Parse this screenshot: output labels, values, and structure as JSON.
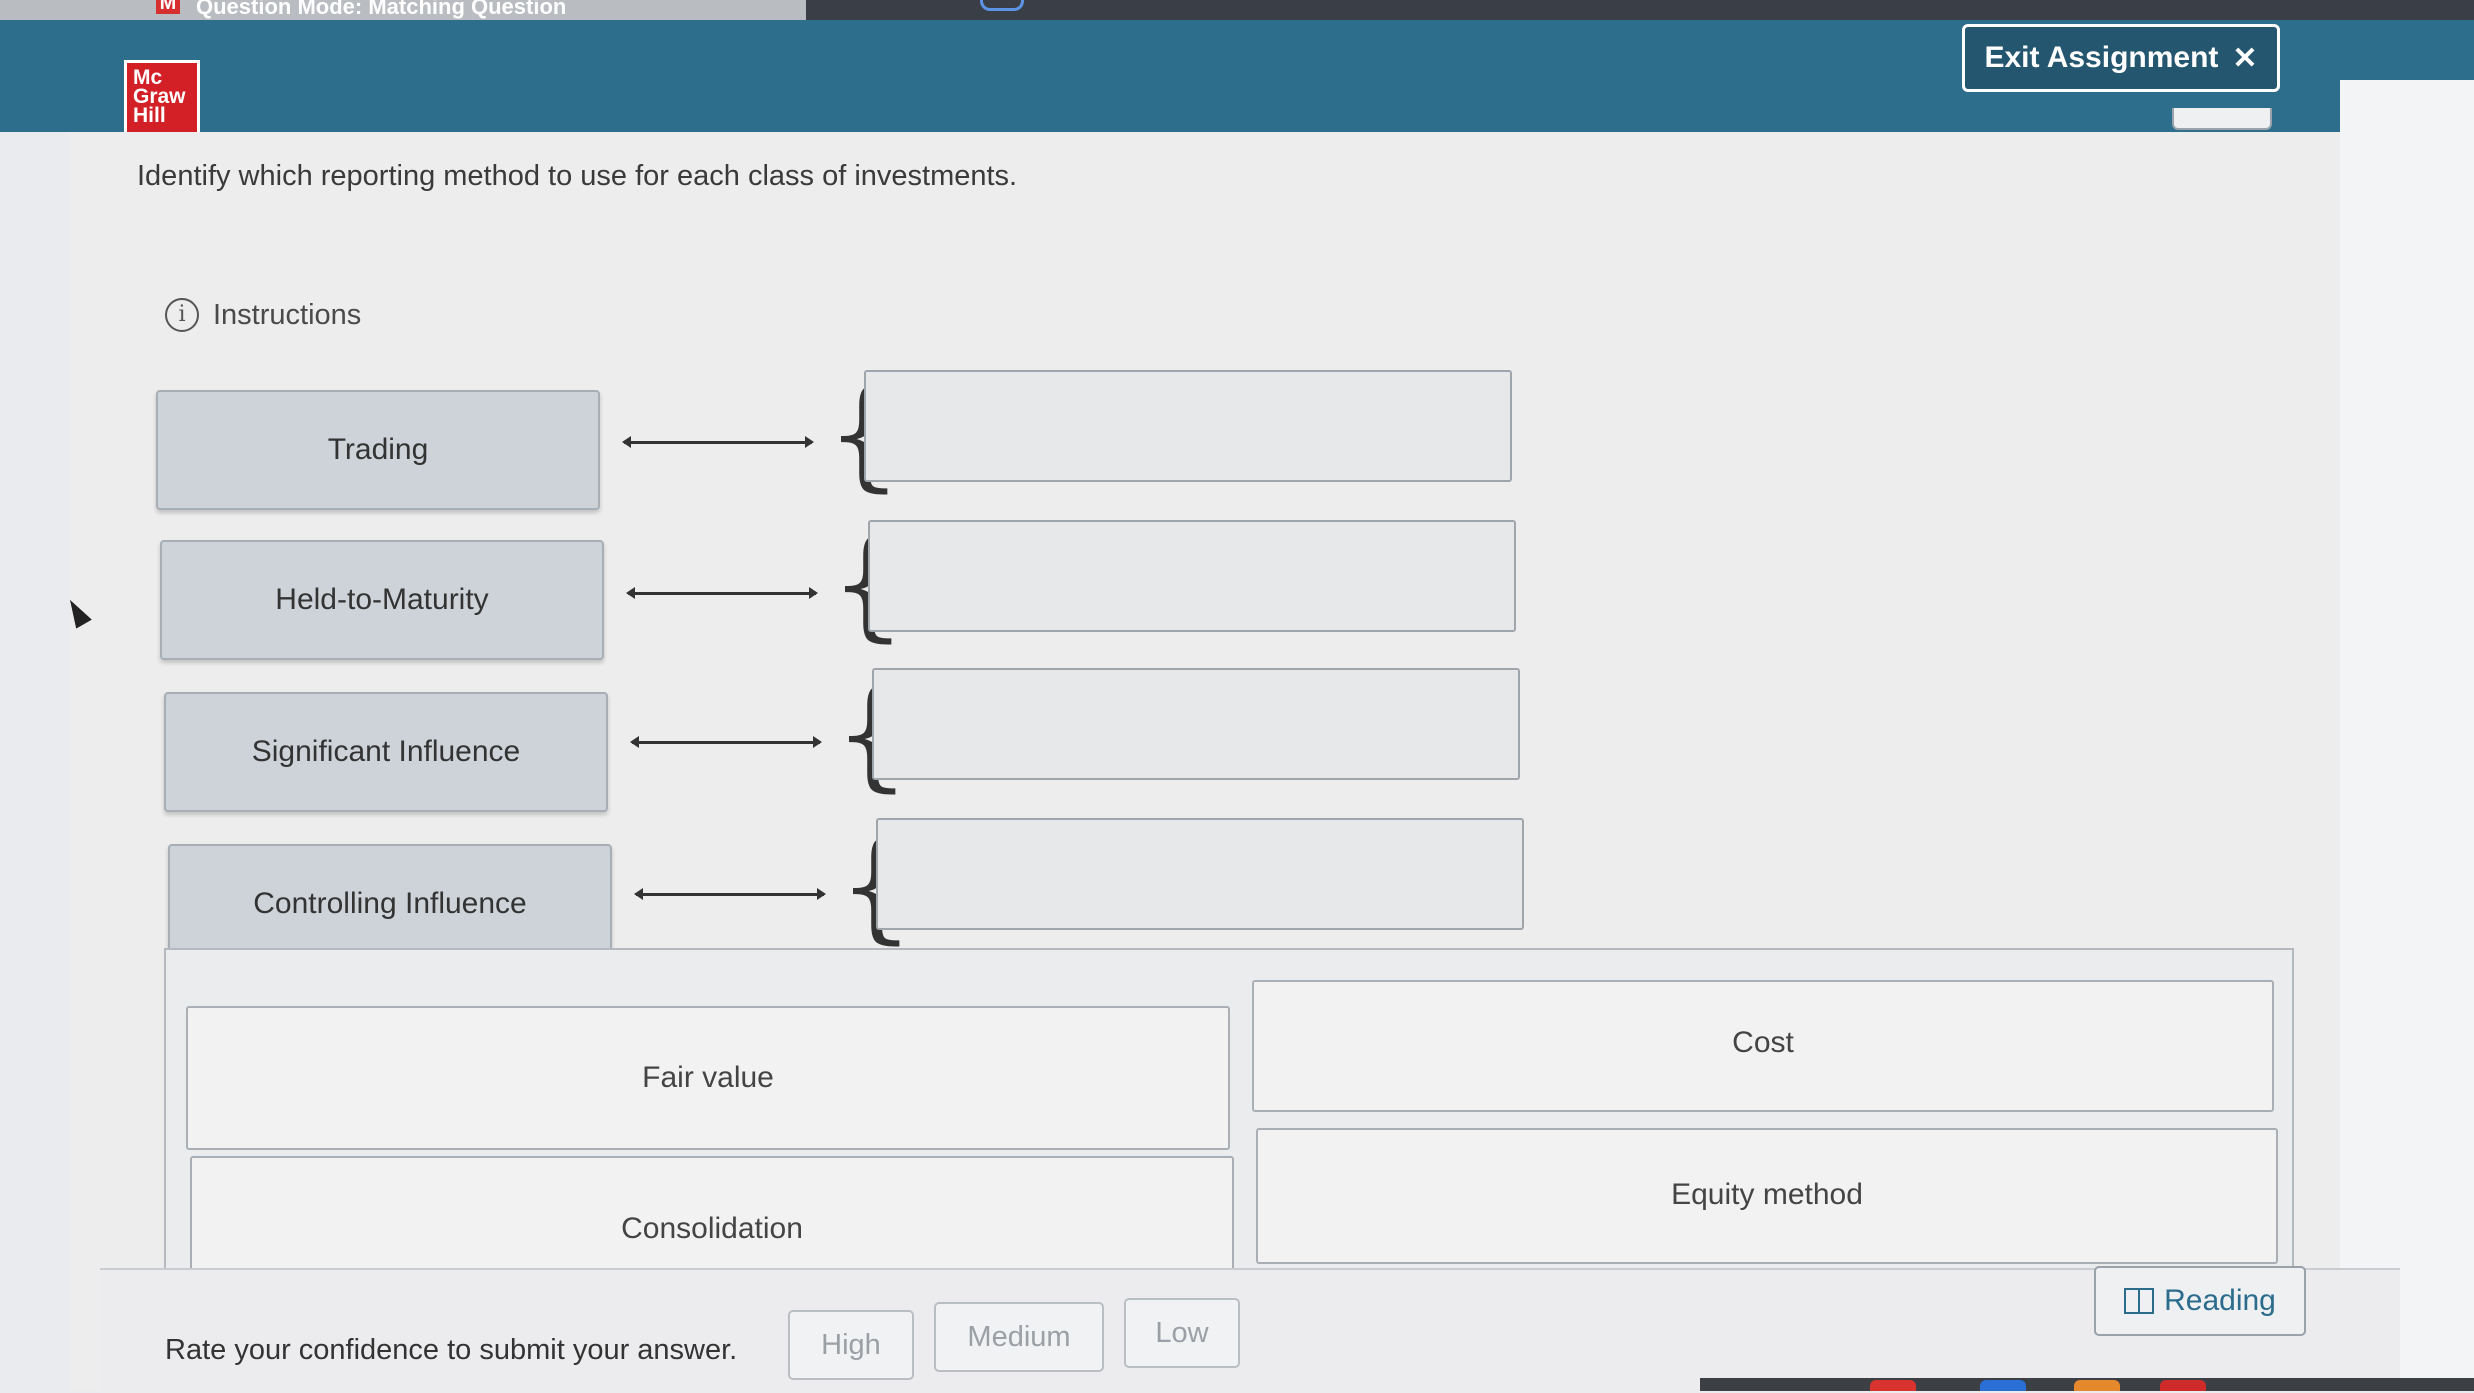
{
  "browser": {
    "tab_icon": "M",
    "tab_title": "Question Mode: Matching Question"
  },
  "header": {
    "logo_lines": [
      "Mc",
      "Graw",
      "Hill"
    ],
    "exit_label": "Exit Assignment",
    "exit_icon": "close-icon",
    "brand_color": "#2d6e8c",
    "logo_color": "#d31f26"
  },
  "question": {
    "prompt": "Identify which reporting method to use for each class of investments.",
    "instructions_label": "Instructions"
  },
  "matching": {
    "left_items": [
      {
        "label": "Trading",
        "answer": ""
      },
      {
        "label": "Held-to-Maturity",
        "answer": ""
      },
      {
        "label": "Significant Influence",
        "answer": ""
      },
      {
        "label": "Controlling Influence",
        "answer": ""
      }
    ],
    "answer_choices": [
      "Fair value",
      "Cost",
      "Consolidation",
      "Equity method"
    ]
  },
  "footer": {
    "confidence_label": "Rate your confidence to submit your answer.",
    "confidence_options": [
      "High",
      "Medium",
      "Low"
    ],
    "reading_label": "Reading"
  }
}
